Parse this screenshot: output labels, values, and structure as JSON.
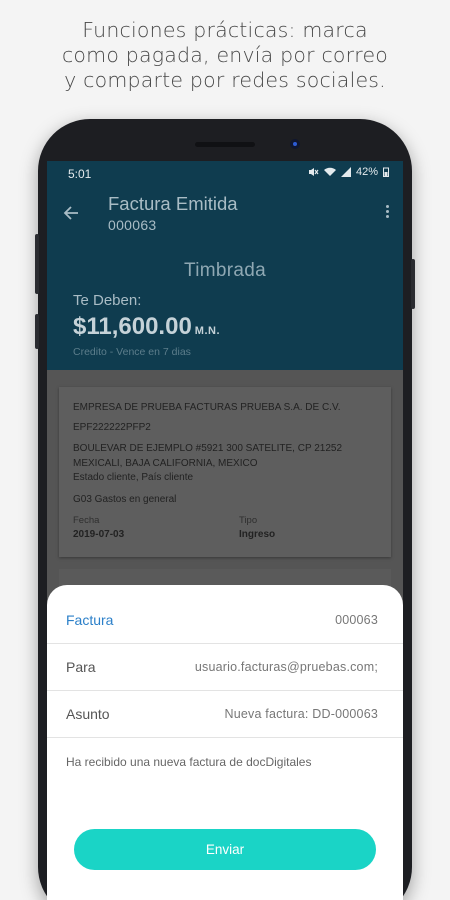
{
  "promo": {
    "line1": "Funciones prácticas: marca",
    "line2": "como pagada, envía por correo",
    "line3": "y comparte por redes sociales."
  },
  "status_bar": {
    "time": "5:01",
    "battery": "42%"
  },
  "header": {
    "title": "Factura Emitida",
    "invoice_number": "000063",
    "state": "Timbrada",
    "owed_label": "Te Deben:",
    "amount": "$11,600.00",
    "currency": "M.N.",
    "credit_note": "Credito - Vence en 7 dias"
  },
  "invoice_card": {
    "company": "EMPRESA DE PRUEBA FACTURAS PRUEBA S.A. DE C.V.",
    "rfc": "EPF222222PFP2",
    "address1": "BOULEVAR DE EJEMPLO #5921 300 SATELITE, CP 21252",
    "address2": "MEXICALI, BAJA CALIFORNIA, MEXICO",
    "client_state": "Estado cliente,  País cliente",
    "use": "G03 Gastos en general",
    "date_label": "Fecha",
    "date_value": "2019-07-03",
    "type_label": "Tipo",
    "type_value": "Ingreso"
  },
  "email_sheet": {
    "invoice_label": "Factura",
    "invoice_value": "000063",
    "to_label": "Para",
    "to_value": "usuario.facturas@pruebas.com;",
    "subject_label": "Asunto",
    "subject_value": "Nueva factura: DD-000063",
    "message": "Ha recibido una nueva factura de docDigitales",
    "send_label": "Enviar"
  },
  "colors": {
    "header_bg": "#0f3c4f",
    "accent_blue": "#2c80c9",
    "send_button": "#1ad4c6"
  }
}
